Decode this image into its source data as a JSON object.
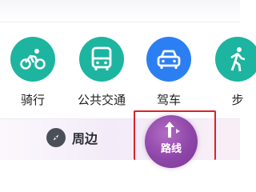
{
  "transport_modes": [
    {
      "label": "骑行",
      "icon": "bicycle-icon",
      "color": "#1db4a0"
    },
    {
      "label": "公共交通",
      "icon": "bus-icon",
      "color": "#1db4a0"
    },
    {
      "label": "驾车",
      "icon": "car-icon",
      "color": "#2b7ff3"
    },
    {
      "label": "步",
      "icon": "walking-icon",
      "color": "#1db4a0"
    }
  ],
  "bottom_bar": {
    "nearby_label": "周边",
    "nearby_icon": "compass-icon",
    "route_label": "路线",
    "route_icon": "route-arrow-icon",
    "route_color": "#8e45a8",
    "highlight_color": "#d9232d"
  }
}
